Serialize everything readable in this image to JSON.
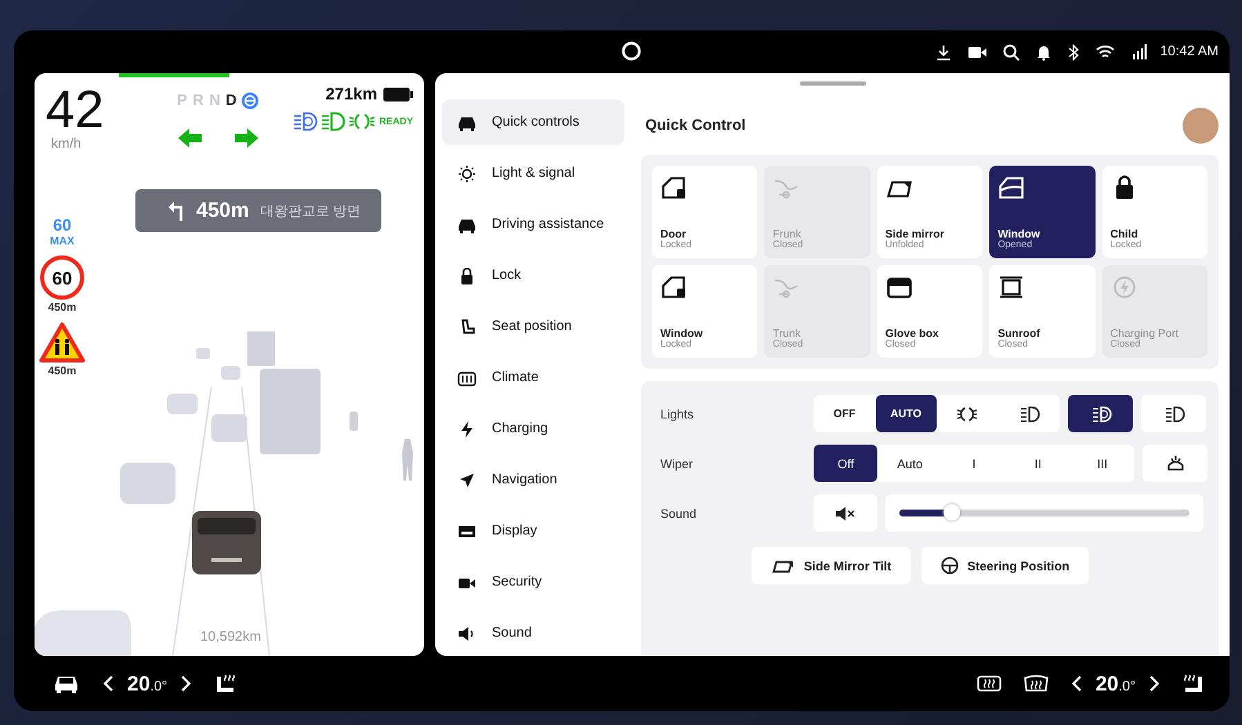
{
  "status_bar": {
    "time": "10:42 AM"
  },
  "cluster": {
    "speed": "42",
    "speed_unit": "km/h",
    "gears": [
      {
        "label": "P",
        "selected": false
      },
      {
        "label": "R",
        "selected": false
      },
      {
        "label": "N",
        "selected": false
      },
      {
        "label": "D",
        "selected": true
      }
    ],
    "range": "271km",
    "ready": "READY",
    "navigation": {
      "distance": "450m",
      "direction": "대왕판교로 방면"
    },
    "speed_limit": {
      "value": "60",
      "label": "MAX"
    },
    "signs": [
      {
        "kind": "speed",
        "value": "60",
        "distance": "450m"
      },
      {
        "kind": "children",
        "distance": "450m"
      }
    ],
    "odometer": "10,592km"
  },
  "sidebar": {
    "items": [
      {
        "label": "Quick controls",
        "selected": true
      },
      {
        "label": "Light & signal",
        "selected": false
      },
      {
        "label": "Driving assistance",
        "selected": false
      },
      {
        "label": "Lock",
        "selected": false
      },
      {
        "label": "Seat position",
        "selected": false
      },
      {
        "label": "Climate",
        "selected": false
      },
      {
        "label": "Charging",
        "selected": false
      },
      {
        "label": "Navigation",
        "selected": false
      },
      {
        "label": "Display",
        "selected": false
      },
      {
        "label": "Security",
        "selected": false
      },
      {
        "label": "Sound",
        "selected": false
      }
    ]
  },
  "quick_control": {
    "title": "Quick Control",
    "tiles": [
      {
        "label": "Door",
        "status": "Locked",
        "selected": false,
        "disabled": false
      },
      {
        "label": "Frunk",
        "status": "Closed",
        "selected": false,
        "disabled": true
      },
      {
        "label": "Side mirror",
        "status": "Unfolded",
        "selected": false,
        "disabled": false
      },
      {
        "label": "Window",
        "status": "Opened",
        "selected": true,
        "disabled": false
      },
      {
        "label": "Child",
        "status": "Locked",
        "selected": false,
        "disabled": false
      },
      {
        "label": "Window",
        "status": "Locked",
        "selected": false,
        "disabled": false
      },
      {
        "label": "Trunk",
        "status": "Closed",
        "selected": false,
        "disabled": true
      },
      {
        "label": "Glove box",
        "status": "Closed",
        "selected": false,
        "disabled": false
      },
      {
        "label": "Sunroof",
        "status": "Closed",
        "selected": false,
        "disabled": false
      },
      {
        "label": "Charging Port",
        "status": "Closed",
        "selected": false,
        "disabled": true
      }
    ],
    "lights": {
      "label": "Lights",
      "segment": [
        {
          "kind": "text",
          "label": "OFF",
          "selected": false
        },
        {
          "kind": "text",
          "label": "AUTO",
          "selected": true
        },
        {
          "kind": "icon",
          "selected": false
        },
        {
          "kind": "icon",
          "selected": false
        }
      ],
      "extra": [
        {
          "selected": true
        },
        {
          "selected": false
        }
      ]
    },
    "wiper": {
      "label": "Wiper",
      "options": [
        {
          "label": "Off",
          "selected": true
        },
        {
          "label": "Auto",
          "selected": false
        },
        {
          "label": "I",
          "selected": false
        },
        {
          "label": "II",
          "selected": false
        },
        {
          "label": "III",
          "selected": false
        }
      ]
    },
    "sound": {
      "label": "Sound",
      "level": 0.18
    },
    "buttons": [
      "Side Mirror Tilt",
      "Steering Position"
    ]
  },
  "climate": {
    "left": {
      "whole": "20",
      "fraction": ".0°"
    },
    "right": {
      "whole": "20",
      "fraction": ".0°"
    }
  }
}
